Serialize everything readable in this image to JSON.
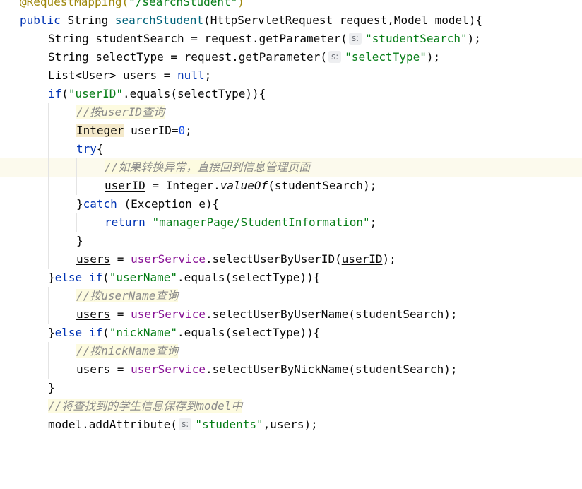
{
  "editor": {
    "lines": [
      {
        "t0": "@RequestMapping(",
        "t1": "\"/searchStudent\"",
        "t2": ")"
      },
      {
        "t0": "public ",
        "t1": "String ",
        "t2": "searchStudent",
        "t3": "(HttpServletRequest request,Model model){"
      },
      {
        "t0": "String studentSearch = request.getParameter(",
        "hint": "s:",
        "t1": "\"studentSearch\"",
        "t2": ");"
      },
      {
        "t0": "String selectType = request.getParameter(",
        "hint": "s:",
        "t1": "\"selectType\"",
        "t2": ");"
      },
      {
        "t0": "List<User> ",
        "t1": "users",
        "t2": " = ",
        "t3": "null",
        "t4": ";"
      },
      {
        "t0": "if",
        "t1": "(",
        "t2": "\"userID\"",
        "t3": ".equals(selectType)){"
      },
      {
        "t0": "//按userID查询"
      },
      {
        "t0": "Integer",
        "t1": " ",
        "t2": "userID",
        "t3": "=",
        "t4": "0",
        "t5": ";"
      },
      {
        "t0": "try",
        "t1": "{"
      },
      {
        "t0": "//如果",
        "t1": "转换异常，直接回到信息管理页面"
      },
      {
        "t0": "userID",
        "t1": " = Integer.",
        "t2": "valueOf",
        "t3": "(studentSearch);"
      },
      {
        "t0": "}",
        "t1": "catch",
        "t2": " (Exception e){"
      },
      {
        "t0": "return ",
        "t1": "\"managerPage/StudentInformation\"",
        "t2": ";"
      },
      {
        "t0": "}"
      },
      {
        "t0": "users",
        "t1": " = ",
        "t2": "userService",
        "t3": ".selectUserByUserID(",
        "t4": "userID",
        "t5": ");"
      },
      {
        "t0": "}",
        "t1": "else if",
        "t2": "(",
        "t3": "\"userName\"",
        "t4": ".equals(selectType)){"
      },
      {
        "t0": "//按userName查询"
      },
      {
        "t0": "users",
        "t1": " = ",
        "t2": "userService",
        "t3": ".selectUserByUserName(studentSearch);"
      },
      {
        "t0": "}",
        "t1": "else if",
        "t2": "(",
        "t3": "\"nickName\"",
        "t4": ".equals(selectType)){"
      },
      {
        "t0": "//按nickName查询"
      },
      {
        "t0": "users",
        "t1": " = ",
        "t2": "userService",
        "t3": ".selectUserByNickName(studentSearch);"
      },
      {
        "t0": "}"
      },
      {
        "t0": "//将查找到的学生信息保存到model中"
      },
      {
        "t0": "model.addAttribute(",
        "hint": "s:",
        "t1": "\"students\"",
        "t2": ",",
        "t3": "users",
        "t4": ");"
      }
    ]
  },
  "colors": {
    "keyword": "#0033b3",
    "string": "#067d17",
    "number": "#1750eb",
    "field": "#871094",
    "comment": "#8c8c8c",
    "annotation": "#9e880d",
    "current_line": "#fcfaed",
    "hint_bg": "#eeeff1"
  }
}
